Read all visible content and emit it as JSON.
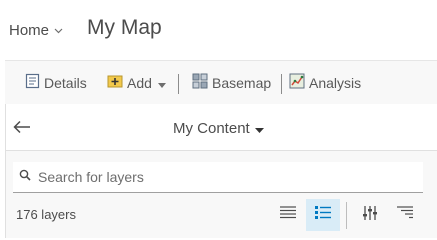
{
  "header": {
    "home_label": "Home",
    "map_title": "My Map"
  },
  "toolbar": {
    "details_label": "Details",
    "add_label": "Add",
    "basemap_label": "Basemap",
    "analysis_label": "Analysis"
  },
  "panel": {
    "content_label": "My Content",
    "search_placeholder": "Search for layers",
    "layer_count": "176 layers",
    "active_view": "detail-list"
  },
  "icons": [
    "chevron-down-icon",
    "details-icon",
    "add-icon",
    "basemap-icon",
    "analysis-icon",
    "back-arrow-icon",
    "caret-down-icon",
    "search-icon",
    "list-view-icon",
    "detail-list-icon",
    "filter-icon",
    "sort-icon"
  ],
  "colors": {
    "accent": "#0079c1",
    "active_bg": "#d9ecf7",
    "text": "#4c4c4c"
  }
}
